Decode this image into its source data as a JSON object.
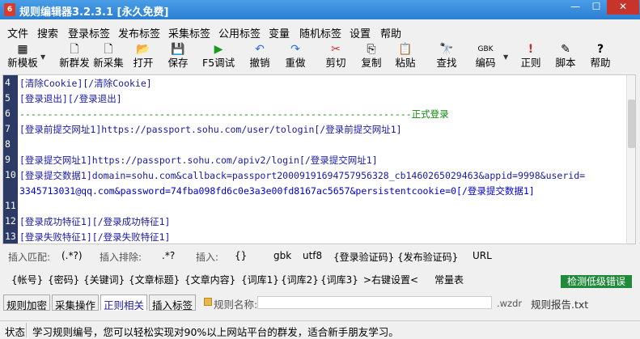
{
  "window": {
    "title": "规则编辑器3.2.3.1 [永久免费]",
    "app_icon_glyph": "6",
    "min_glyph": "—",
    "max_glyph": "☐",
    "close_glyph": "✕"
  },
  "menu": [
    "文件",
    "搜索",
    "登录标签",
    "发布标签",
    "采集标签",
    "公用标签",
    "变量",
    "随机标签",
    "设置",
    "帮助"
  ],
  "toolbar": [
    {
      "label": "新模板",
      "icon": "▦",
      "name": "new-template-button"
    },
    {
      "label": "新群发",
      "icon": "🗋",
      "name": "new-broadcast-button"
    },
    {
      "label": "新采集",
      "icon": "🗋",
      "name": "new-collect-button"
    },
    {
      "label": "打开",
      "icon": "📂",
      "name": "open-button"
    },
    {
      "label": "保存",
      "icon": "💾",
      "name": "save-button"
    },
    {
      "label": "F5调试",
      "icon": "▶",
      "name": "debug-button"
    },
    {
      "label": "撤销",
      "icon": "↶",
      "name": "undo-button"
    },
    {
      "label": "重做",
      "icon": "↷",
      "name": "redo-button"
    },
    {
      "label": "剪切",
      "icon": "✂",
      "name": "cut-button"
    },
    {
      "label": "复制",
      "icon": "⎘",
      "name": "copy-button"
    },
    {
      "label": "粘贴",
      "icon": "📋",
      "name": "paste-button"
    },
    {
      "label": "查找",
      "icon": "🔭",
      "name": "find-button"
    },
    {
      "label": "编码",
      "icon": "GBK",
      "name": "encoding-button"
    },
    {
      "label": "正则",
      "icon": "!",
      "name": "regex-button"
    },
    {
      "label": "脚本",
      "icon": "✎",
      "name": "script-button"
    },
    {
      "label": "帮助",
      "icon": "?",
      "name": "help-button"
    }
  ],
  "editor": {
    "lines": [
      {
        "num": "4",
        "text": "[清除Cookie][/清除Cookie]"
      },
      {
        "num": "5",
        "text": "[登录退出][/登录退出]"
      },
      {
        "num": "6",
        "text": "----------------------------------------------------------------------正式登录"
      },
      {
        "num": "7",
        "text": "[登录前提交网址1]https://passport.sohu.com/user/tologin[/登录前提交网址1]"
      },
      {
        "num": "8",
        "text": ""
      },
      {
        "num": "9",
        "text": "[登录提交网址1]https://passport.sohu.com/apiv2/login[/登录提交网址1]"
      },
      {
        "num": "10",
        "text": "[登录提交数据1]domain=sohu.com&callback=passport20009191694757956328_cb1460265029463&appid=9998&userid="
      },
      {
        "num": "",
        "text": "3345713031@qq.com&password=74fba098fd6c0e3a3e00fd8167ac5657&persistentcookie=0[/登录提交数据1]"
      },
      {
        "num": "11",
        "text": ""
      },
      {
        "num": "12",
        "text": "[登录成功特征1][/登录成功特征1]"
      },
      {
        "num": "13",
        "text": "[登录失败特征1][/登录失败特征1]"
      }
    ]
  },
  "insert_row": {
    "match_label": "插入匹配:",
    "match_value": "(.*?)",
    "exclude_label": "插入排除:",
    "exclude_value": ".*?",
    "insert_label": "插入:",
    "items": [
      "{}",
      "gbk",
      "utf8",
      "{登录验证码}",
      "{发布验证码}",
      "URL"
    ]
  },
  "var_row": {
    "items": [
      "{帐号}",
      "{密码}",
      "{关键词}",
      "{文章标题}",
      "{文章内容}",
      "{词库1}",
      "{词库2}",
      "{词库3}",
      ">右键设置<",
      "常量表"
    ],
    "detect_label": "检测低级错误"
  },
  "tabs": [
    "规则加密",
    "采集操作",
    "正则相关",
    "插入标签"
  ],
  "active_tab": 2,
  "rule_name": {
    "label": "规则名称:",
    "value": "",
    "ext": ".wzdr",
    "report": "规则报告.txt"
  },
  "status": {
    "label": "状态",
    "text": "学习规则编号，您可以轻松实现对90%以上网站平台的群发，适合新手朋友学习。"
  },
  "colors": {
    "titlebar": "#2a7fd2",
    "gutter": "#2b3b66",
    "tag": "#1a1aa6",
    "detect_button": "#1f8a3a"
  }
}
